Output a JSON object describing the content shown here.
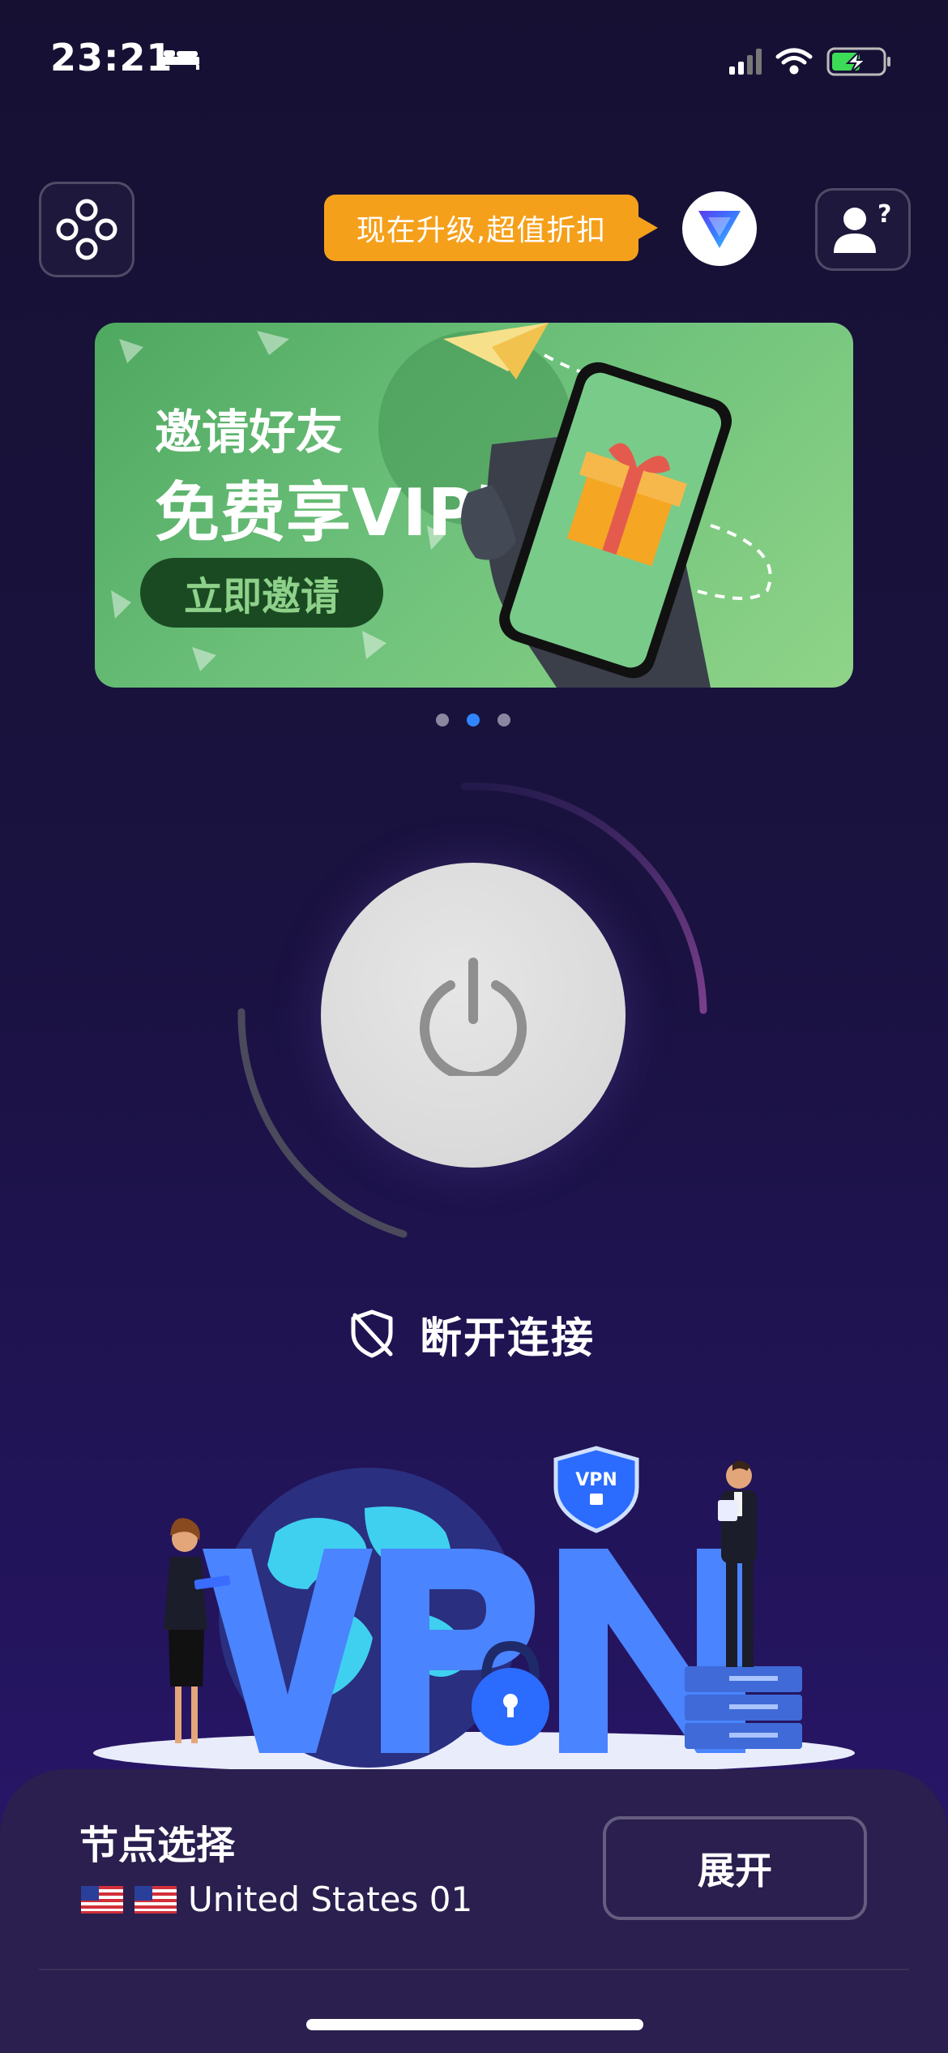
{
  "status_bar": {
    "time": "23:21",
    "icons": [
      "bed-icon",
      "cellular-signal-icon",
      "wifi-icon",
      "battery-charging-icon"
    ]
  },
  "header": {
    "menu_icon": "four-circles-menu-icon",
    "upgrade_text": "现在升级,超值折扣",
    "premium_icon": "premium-v-logo-icon",
    "profile_icon": "user-help-icon"
  },
  "banner": {
    "line1": "邀请好友",
    "line2": "免费享VIP特权",
    "cta": "立即邀请",
    "art": "hand-holding-phone-with-gift-and-paper-plane",
    "colors": {
      "bg_start": "#4fa860",
      "bg_end": "#8fd488",
      "cta_bg": "#1a4a22"
    }
  },
  "carousel": {
    "count": 3,
    "active_index": 1
  },
  "connection": {
    "power_icon": "power-icon",
    "status_icon": "shield-off-icon",
    "status_text": "断开连接"
  },
  "illustration": {
    "letters": "VPN",
    "shield_text": "VPN",
    "elements": [
      "globe",
      "woman-with-tablet",
      "man-with-badge",
      "padlock",
      "server-rack",
      "vpn-shield"
    ]
  },
  "node_selector": {
    "title": "节点选择",
    "flags": [
      "us-flag-icon",
      "us-flag-icon"
    ],
    "server": "United States 01",
    "expand_label": "展开"
  },
  "colors": {
    "accent_blue": "#2f86ff",
    "upgrade_orange": "#f5a01b",
    "panel_bg": "#2a1f4e",
    "vpn_letters": "#4a84ff"
  }
}
